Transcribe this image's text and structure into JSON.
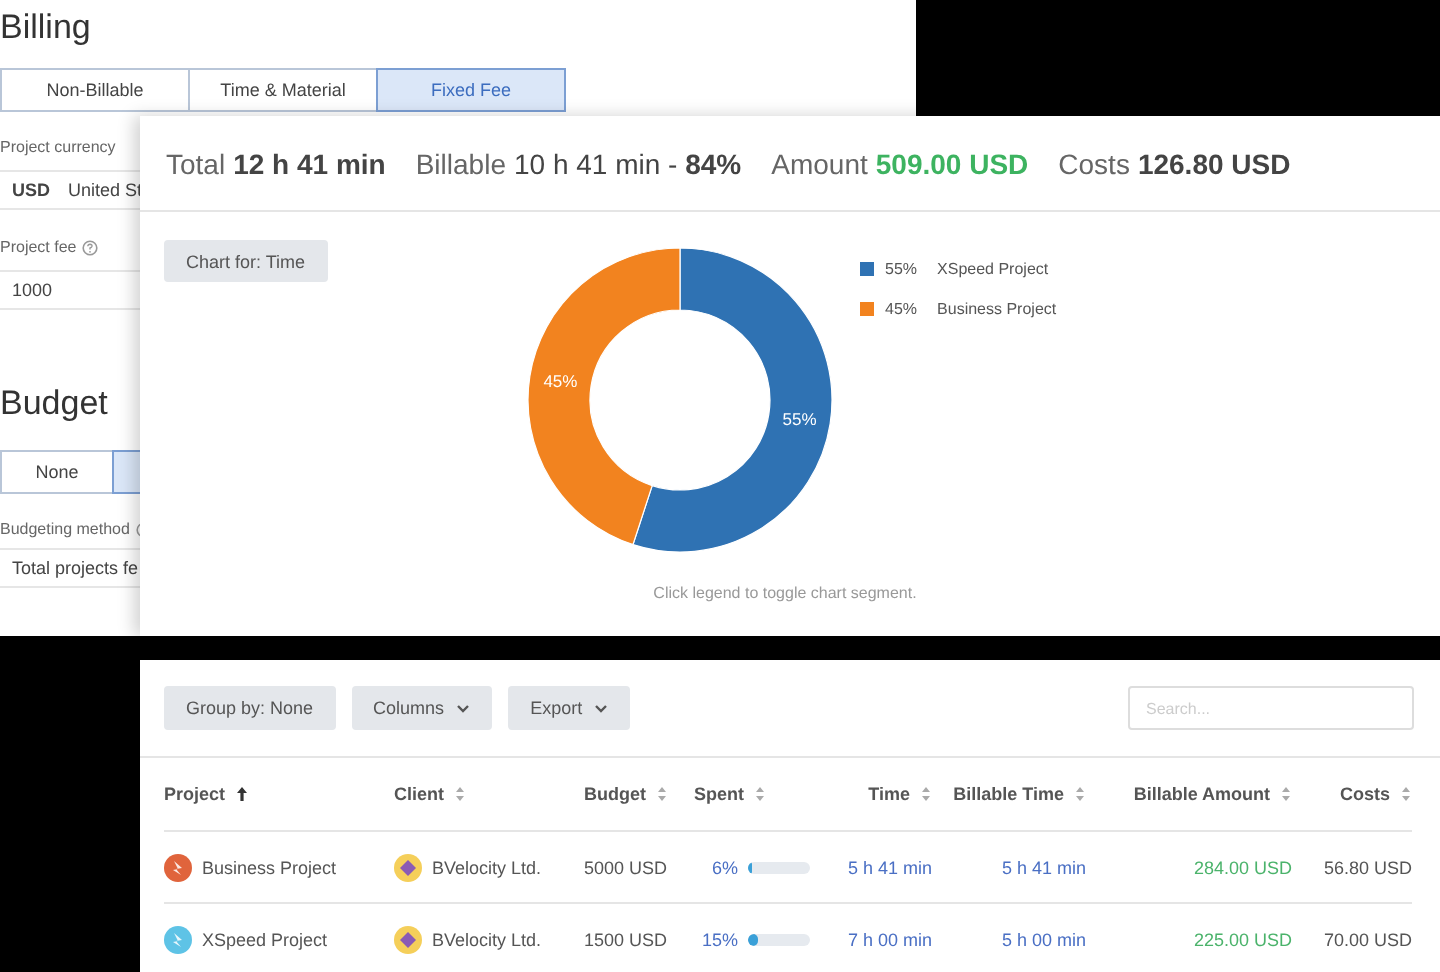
{
  "billing": {
    "title": "Billing",
    "options": [
      {
        "label": "Non-Billable",
        "selected": false
      },
      {
        "label": "Time & Material",
        "selected": false
      },
      {
        "label": "Fixed Fee",
        "selected": true
      }
    ],
    "currency_label": "Project currency",
    "currency_code": "USD",
    "currency_name": "United St",
    "fee_label": "Project fee",
    "fee_value": "1000"
  },
  "budget": {
    "title": "Budget",
    "options": [
      {
        "label": "None",
        "selected": false
      },
      {
        "selected": true
      }
    ],
    "method_label": "Budgeting method",
    "method_value": "Total projects fe"
  },
  "summary": {
    "stats": [
      {
        "label": "Total",
        "value": "12 h 41 min",
        "kind": "bold"
      },
      {
        "label": "Billable",
        "value": "10 h 41 min - **84%**",
        "kind": "rich"
      },
      {
        "label": "Amount",
        "value": "509.00 USD",
        "kind": "positive"
      },
      {
        "label": "Costs",
        "value": "126.80 USD",
        "kind": "bold"
      }
    ],
    "chart_button": "Chart for: Time",
    "chart_data": {
      "type": "donut",
      "categories": [
        "XSpeed Project",
        "Business Project"
      ],
      "values": [
        55,
        45
      ],
      "colors": [
        "#2f72b3",
        "#f2831f"
      ],
      "value_labels": [
        "55%",
        "45%"
      ]
    },
    "legend": [
      {
        "percent": "55%",
        "color": "#2f72b3"
      },
      {
        "percent": "45%",
        "color": "#f2831f"
      }
    ],
    "hint": "Click legend to toggle chart segment."
  },
  "report": {
    "toolbar": [
      {
        "label": "Group by: None",
        "dropdown": false
      },
      {
        "label": "Columns",
        "dropdown": true
      },
      {
        "label": "Export",
        "dropdown": true
      }
    ],
    "search": {
      "placeholder": "Search..."
    },
    "columns": [
      {
        "label": "Project",
        "sorted": true
      },
      {
        "label": "Client",
        "sorted": false
      },
      {
        "label": "Budget",
        "sorted": false
      },
      {
        "label": "Spent",
        "sorted": false
      },
      {
        "label": "Time",
        "sorted": false
      },
      {
        "label": "Billable Time",
        "sorted": false
      },
      {
        "label": "Billable Amount",
        "sorted": false
      },
      {
        "label": "Costs",
        "sorted": false
      }
    ],
    "rows": [
      {
        "project": "Business Project",
        "color": "#e0643c",
        "client": "BVelocity Ltd.",
        "budget": "5000 USD",
        "spent": "6%",
        "level": 0.06,
        "time": "5 h 41 min",
        "billable_time": "5 h 41 min",
        "billable_amount": "284.00 USD",
        "costs": "56.80 USD"
      },
      {
        "project": "XSpeed Project",
        "color": "#5ec3e6",
        "client": "BVelocity Ltd.",
        "budget": "1500 USD",
        "spent": "15%",
        "level": 0.15,
        "time": "7 h 00 min",
        "billable_time": "5 h 00 min",
        "billable_amount": "225.00 USD",
        "costs": "70.00 USD"
      }
    ]
  }
}
